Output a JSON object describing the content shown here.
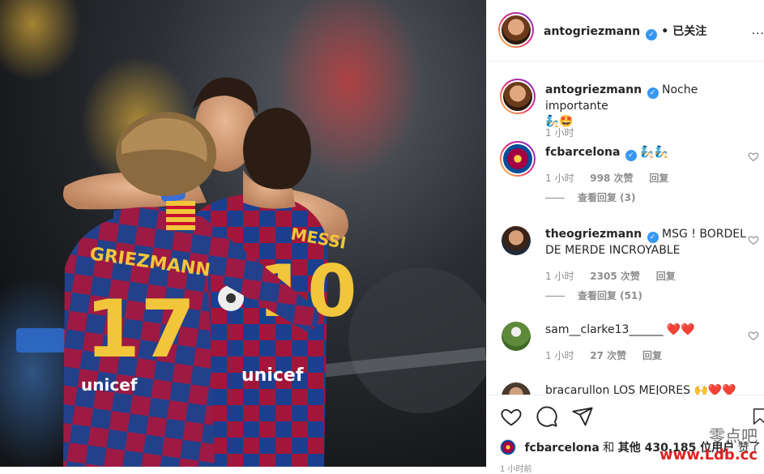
{
  "header": {
    "username": "antogriezmann",
    "separator": "•",
    "follow_status": "已关注",
    "more": "..."
  },
  "caption": {
    "username": "antogriezmann",
    "text": "Noche importante",
    "emojis": "🧞🤩",
    "time": "1 小时"
  },
  "comments": [
    {
      "username": "fcbarcelona",
      "verified": true,
      "text": "🧞🧞",
      "time": "1 小时",
      "likes": "998 次赞",
      "reply": "回复",
      "view_replies": "查看回复 (3)"
    },
    {
      "username": "theogriezmann",
      "verified": true,
      "text": "MSG ! BORDEL DE MERDE INCROYABLE",
      "time": "1 小时",
      "likes": "2305 次赞",
      "reply": "回复",
      "view_replies": "查看回复 (51)"
    },
    {
      "username": "sam__clarke13______",
      "verified": false,
      "text": "❤️❤️",
      "time": "1 小时",
      "likes": "27 次赞",
      "reply": "回复"
    },
    {
      "username": "bracarullon",
      "verified": false,
      "text": "LOS MEJORES 🙌❤️❤️"
    }
  ],
  "likes_line": {
    "user": "fcbarcelona",
    "conj": "和",
    "others": "其他 430,185 位用户",
    "suffix": "赞了"
  },
  "post_time": "1 小时前",
  "watermark": {
    "line1": "零点吧",
    "line2": "www.Ldb.cc"
  },
  "photo": {
    "jersey_numbers": [
      "17",
      "10"
    ],
    "jersey_names": [
      "GRIEZMANN",
      "MESSI"
    ],
    "sponsor": "unicef"
  },
  "colors": {
    "blaugrana_blue": "#1b3f8f",
    "blaugrana_red": "#a3163a",
    "verified_blue": "#3897f0",
    "heart_red": "#ed4956"
  }
}
